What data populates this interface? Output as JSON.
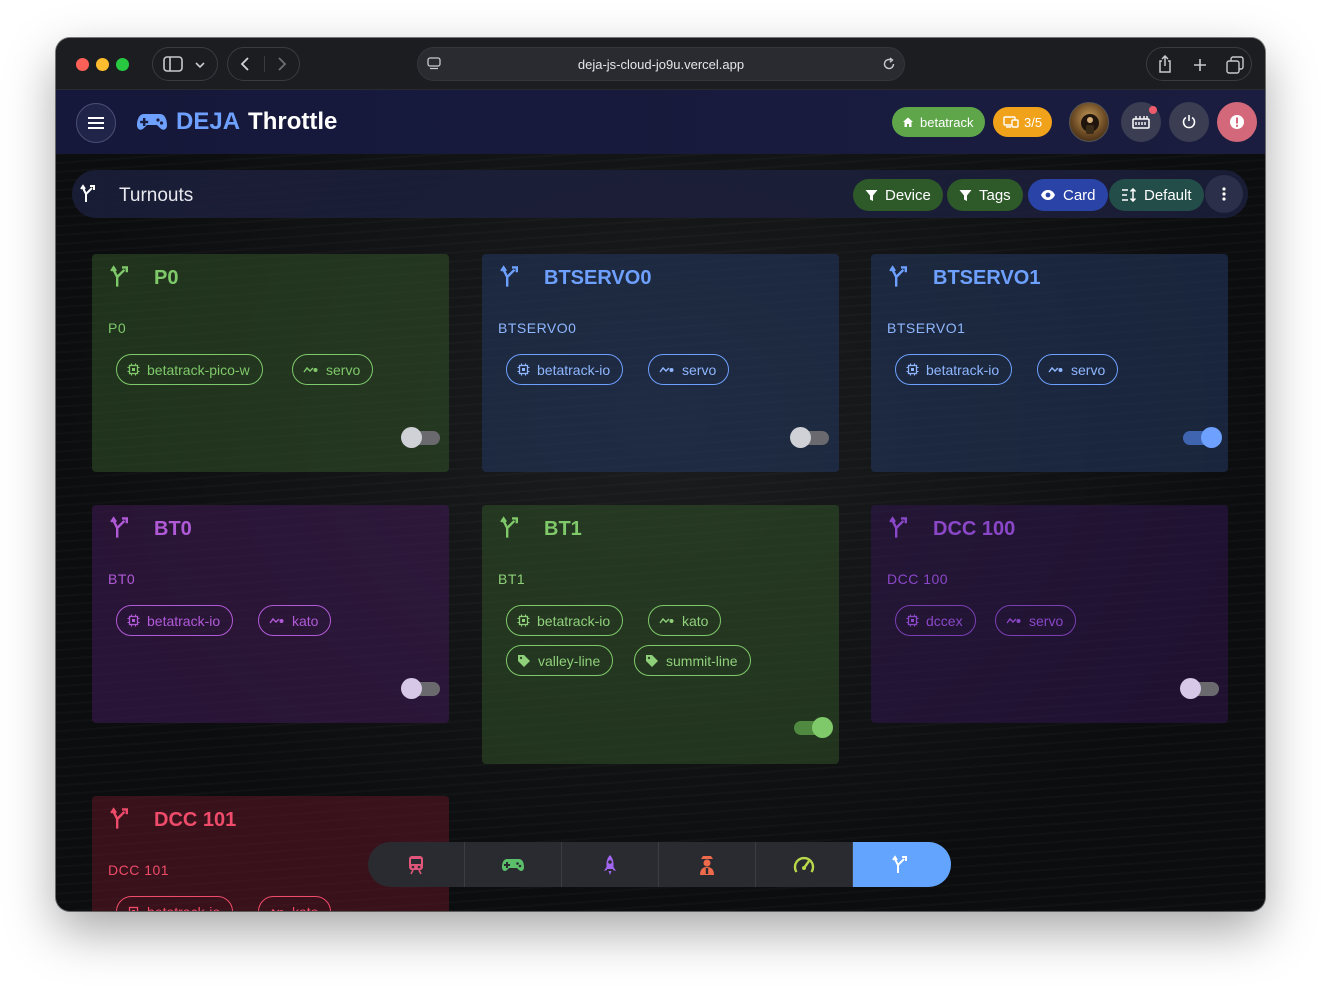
{
  "browser": {
    "url": "deja-js-cloud-jo9u.vercel.app"
  },
  "header": {
    "logo_deja": "DEJA",
    "logo_rest": "Throttle",
    "layout_chip": "betatrack",
    "count_chip": "3/5"
  },
  "page": {
    "title": "Turnouts",
    "filters": {
      "device": "Device",
      "tags": "Tags",
      "view": "Card",
      "sort": "Default"
    }
  },
  "colors": {
    "green": "#7fc96a",
    "blue": "#6ea0ff",
    "purple": "#b15ad8",
    "violet": "#8a47c8",
    "red": "#ef4b6a"
  },
  "turnouts": [
    {
      "name": "P0",
      "sub": "P0",
      "tags": [
        "betatrack-pico-w",
        "servo"
      ],
      "on": false
    },
    {
      "name": "BTSERVO0",
      "sub": "BTSERVO0",
      "tags": [
        "betatrack-io",
        "servo"
      ],
      "on": false
    },
    {
      "name": "BTSERVO1",
      "sub": "BTSERVO1",
      "tags": [
        "betatrack-io",
        "servo"
      ],
      "on": true
    },
    {
      "name": "BT0",
      "sub": "BT0",
      "tags": [
        "betatrack-io",
        "kato"
      ],
      "on": false
    },
    {
      "name": "BT1",
      "sub": "BT1",
      "tags": [
        "betatrack-io",
        "kato",
        "valley-line",
        "summit-line"
      ],
      "on": true
    },
    {
      "name": "DCC 100",
      "sub": "DCC 100",
      "tags": [
        "dccex",
        "servo"
      ],
      "on": false
    },
    {
      "name": "DCC 101",
      "sub": "DCC 101",
      "tags": [
        "betatrack-io",
        "kato"
      ],
      "on": false
    }
  ],
  "bottom_nav": [
    "train-icon",
    "gamepad-icon",
    "rocket-icon",
    "conductor-icon",
    "speedometer-icon",
    "turnout-icon"
  ]
}
